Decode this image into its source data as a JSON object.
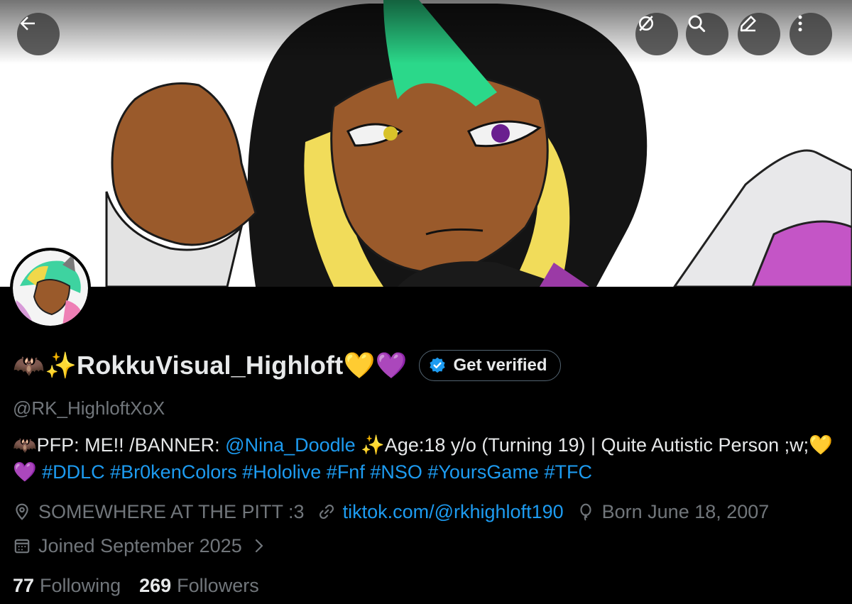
{
  "profile": {
    "display_name": "🦇✨RokkuVisual_Highloft💛💜",
    "handle": "@RK_HighloftXoX",
    "verify_label": "Get verified"
  },
  "bio": {
    "part1": "🦇PFP: ME!! /BANNER: ",
    "mention": "@Nina_Doodle",
    "part2": "  ✨Age:18 y/o (Turning 19) | Quite Autistic Person ;w;💛💜  ",
    "hashtags": "#DDLC #Br0kenColors #Hololive #Fnf #NSO #YoursGame #TFC"
  },
  "meta": {
    "location": "SOMEWHERE AT THE PITT :3",
    "website": "tiktok.com/@rkhighloft190",
    "birthday": "Born June 18, 2007",
    "joined": "Joined September 2025"
  },
  "counts": {
    "following_num": "77",
    "following_label": "Following",
    "followers_num": "269",
    "followers_label": "Followers"
  },
  "icons": {
    "back": "back-arrow-icon",
    "grok": "grok-icon",
    "search": "search-icon",
    "edit": "edit-icon",
    "more": "more-vertical-icon",
    "verified": "verified-badge-icon",
    "location": "location-pin-icon",
    "link": "link-icon",
    "birthday": "balloon-icon",
    "calendar": "calendar-icon"
  },
  "colors": {
    "background": "#000000",
    "primary_text": "#e7e9ea",
    "secondary_text": "#71767b",
    "link": "#1d9bf0",
    "verified": "#1d9bf0"
  }
}
